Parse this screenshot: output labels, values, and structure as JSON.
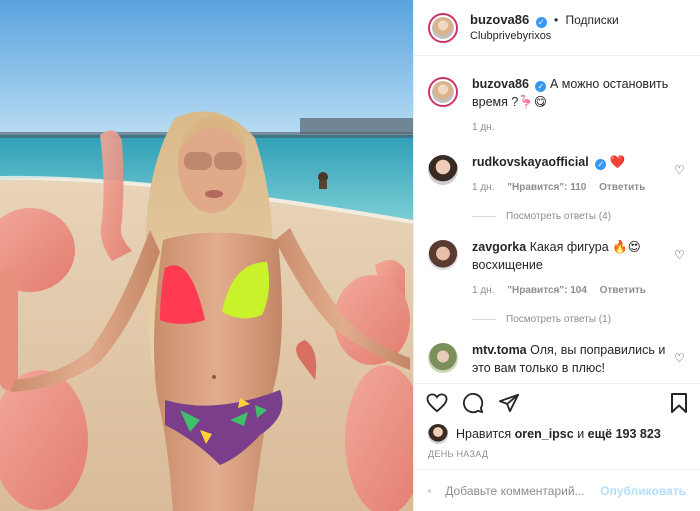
{
  "post": {
    "author": "buzova86",
    "verified_mark": "✓",
    "follow_label": "Подписки",
    "location": "Clubprivebyrixos",
    "caption": "А можно остановить время ?🦩😋",
    "caption_age": "1 дн."
  },
  "comments": [
    {
      "user": "rudkovskayaofficial",
      "text": "❤️",
      "age": "1 дн.",
      "likes_label": "\"Нравится\": 110",
      "reply_label": "Ответить",
      "view_replies": "Посмотреть ответы (4)"
    },
    {
      "user": "zavgorka",
      "text": "Какая фигура 🔥😍 восхищение",
      "age": "1 дн.",
      "likes_label": "\"Нравится\": 104",
      "reply_label": "Ответить",
      "view_replies": "Посмотреть ответы (1)"
    },
    {
      "user": "mtv.toma",
      "text": "Оля, вы поправились и это вам только в плюс!"
    }
  ],
  "likes": {
    "prefix": "Нравится",
    "user": "oren_ipsc",
    "connector": "и",
    "others": "ещё 193 823"
  },
  "date": "ДЕНЬ НАЗАД",
  "add_comment": {
    "placeholder": "Добавьте комментарий...",
    "publish_label": "Опубликовать"
  },
  "icons": {
    "like": "heart-icon",
    "comment": "comment-icon",
    "share": "share-icon",
    "save": "bookmark-icon",
    "emoji": "emoji-icon"
  },
  "colors": {
    "verified": "#3897f0",
    "story_ring": "#c9356b",
    "publish_disabled": "#b2dffc",
    "muted_text": "#8e8e8e"
  }
}
